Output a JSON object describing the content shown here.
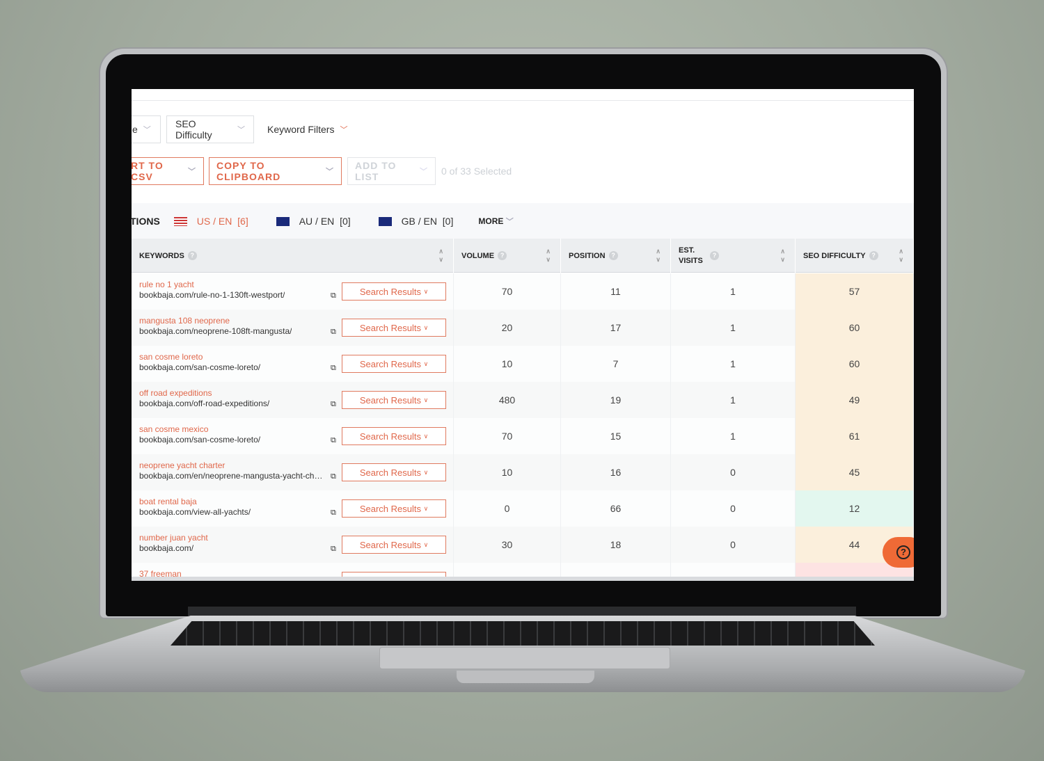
{
  "filters": {
    "partial_filter": "e",
    "seo_difficulty": "SEO Difficulty",
    "keyword_filters": "Keyword Filters"
  },
  "actions": {
    "export_csv": "RT TO CSV",
    "copy_clipboard": "COPY TO CLIPBOARD",
    "add_to_list": "ADD TO LIST",
    "selected_count": "0 of 33 Selected"
  },
  "locations": {
    "label": "TIONS",
    "items": [
      {
        "flag": "us-flag-icon",
        "label": "US / EN",
        "count": "[6]",
        "active": true
      },
      {
        "flag": "au-flag-icon",
        "label": "AU / EN",
        "count": "[0]",
        "active": false
      },
      {
        "flag": "gb-flag-icon",
        "label": "GB / EN",
        "count": "[0]",
        "active": false
      }
    ],
    "more": "MORE"
  },
  "table": {
    "columns": [
      "KEYWORDS",
      "VOLUME",
      "POSITION",
      "EST. VISITS",
      "SEO DIFFICULTY"
    ],
    "search_results_label": "Search Results",
    "rows": [
      {
        "keyword": "rule no 1 yacht",
        "url": "bookbaja.com/rule-no-1-130ft-westport/",
        "volume": "70",
        "position": "11",
        "visits": "1",
        "difficulty": "57",
        "level": "medium"
      },
      {
        "keyword": "mangusta 108 neoprene",
        "url": "bookbaja.com/neoprene-108ft-mangusta/",
        "volume": "20",
        "position": "17",
        "visits": "1",
        "difficulty": "60",
        "level": "medium"
      },
      {
        "keyword": "san cosme loreto",
        "url": "bookbaja.com/san-cosme-loreto/",
        "volume": "10",
        "position": "7",
        "visits": "1",
        "difficulty": "60",
        "level": "medium"
      },
      {
        "keyword": "off road expeditions",
        "url": "bookbaja.com/off-road-expeditions/",
        "volume": "480",
        "position": "19",
        "visits": "1",
        "difficulty": "49",
        "level": "medium"
      },
      {
        "keyword": "san cosme mexico",
        "url": "bookbaja.com/san-cosme-loreto/",
        "volume": "70",
        "position": "15",
        "visits": "1",
        "difficulty": "61",
        "level": "medium"
      },
      {
        "keyword": "neoprene yacht charter",
        "url": "bookbaja.com/en/neoprene-mangusta-yacht-charter",
        "volume": "10",
        "position": "16",
        "visits": "0",
        "difficulty": "45",
        "level": "medium"
      },
      {
        "keyword": "boat rental baja",
        "url": "bookbaja.com/view-all-yachts/",
        "volume": "0",
        "position": "66",
        "visits": "0",
        "difficulty": "12",
        "level": "easy"
      },
      {
        "keyword": "number juan yacht",
        "url": "bookbaja.com/",
        "volume": "30",
        "position": "18",
        "visits": "0",
        "difficulty": "44",
        "level": "medium"
      },
      {
        "keyword": "37 freeman",
        "url": "",
        "volume": "",
        "position": "",
        "visits": "",
        "difficulty": "",
        "level": "hard"
      }
    ]
  },
  "colors": {
    "accent": "#e0674a",
    "medium": "#fbefdc",
    "easy": "#e3f7ef",
    "hard": "#fde3e3",
    "fab": "#ef6a36"
  }
}
